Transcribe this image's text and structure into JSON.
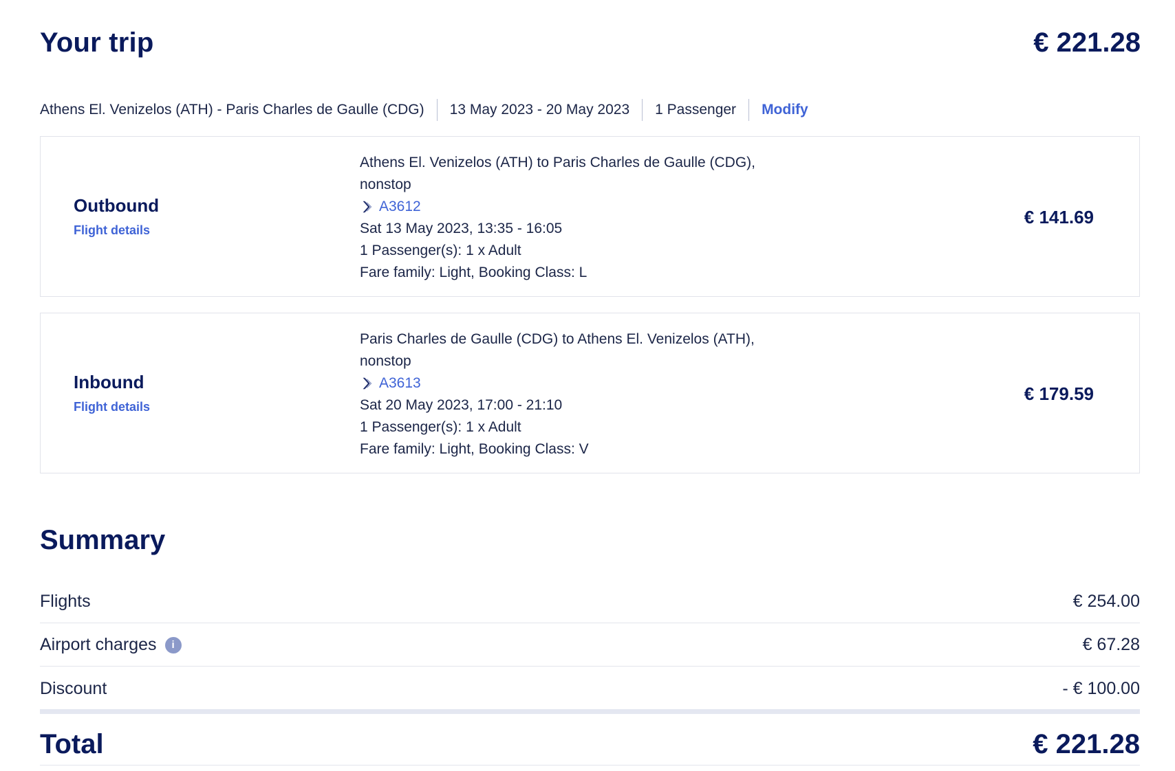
{
  "trip": {
    "title": "Your trip",
    "total": "€ 221.28"
  },
  "search": {
    "route": "Athens El. Venizelos (ATH) - Paris Charles de Gaulle (CDG)",
    "dates": "13 May 2023 - 20 May 2023",
    "passengers": "1 Passenger",
    "modify_label": "Modify"
  },
  "flights": [
    {
      "direction": "Outbound",
      "details_link": "Flight details",
      "route_line1": "Athens El. Venizelos (ATH) to Paris Charles de Gaulle (CDG),",
      "route_line2": "nonstop",
      "flight_number": "A3612",
      "schedule": "Sat 13 May 2023, 13:35 - 16:05",
      "passengers": "1 Passenger(s): 1 x Adult",
      "fare": "Fare family: Light, Booking Class: L",
      "price": "€ 141.69"
    },
    {
      "direction": "Inbound",
      "details_link": "Flight details",
      "route_line1": "Paris Charles de Gaulle (CDG) to Athens El. Venizelos (ATH),",
      "route_line2": "nonstop",
      "flight_number": "A3613",
      "schedule": "Sat 20 May 2023, 17:00 - 21:10",
      "passengers": "1 Passenger(s): 1 x Adult",
      "fare": "Fare family: Light, Booking Class: V",
      "price": "€ 179.59"
    }
  ],
  "summary": {
    "title": "Summary",
    "rows": [
      {
        "label": "Flights",
        "value": "€ 254.00"
      },
      {
        "label": "Airport charges",
        "value": "€ 67.28",
        "info_icon": "info-icon"
      },
      {
        "label": "Discount",
        "value": "- € 100.00"
      }
    ],
    "total_label": "Total",
    "total_value": "€ 221.28"
  },
  "colors": {
    "brand_navy": "#0a1a5c",
    "link_blue": "#3f63d6",
    "info_icon_bg": "#8b99c9"
  }
}
